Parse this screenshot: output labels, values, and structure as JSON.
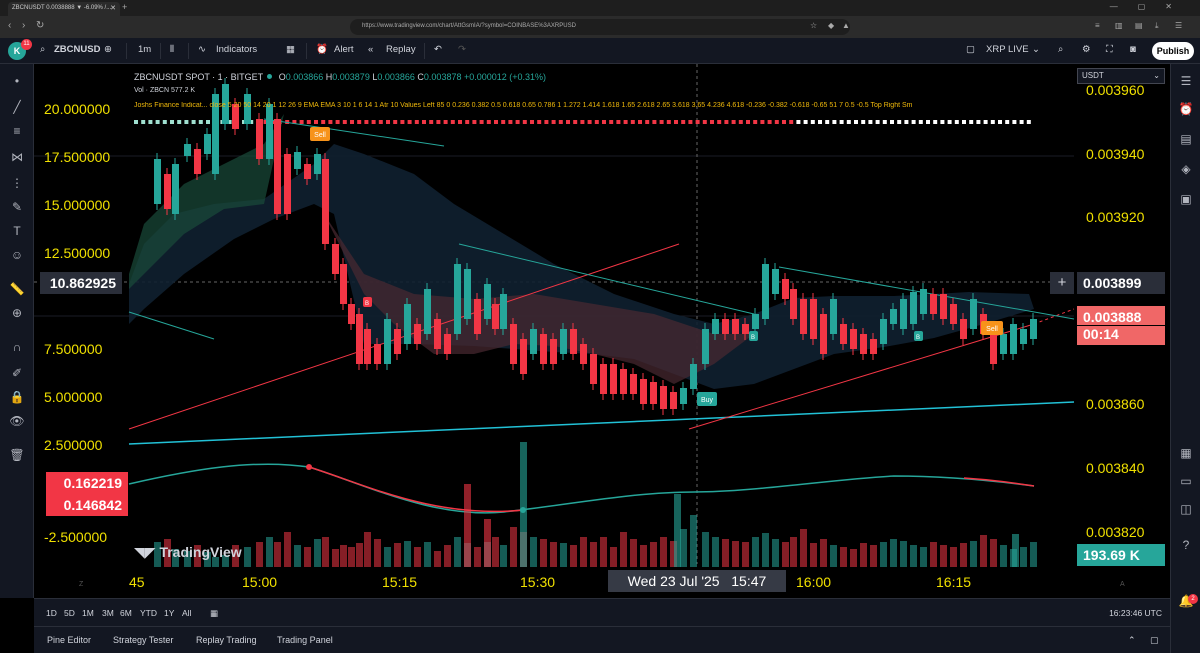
{
  "browser": {
    "tab_title": "ZBCNUSDT 0.0038888 ▼ -6.09% /...",
    "url": "https://www.tradingview.com/chart/AttGsmIA/?symbol=COINBASE%3AXRPUSD"
  },
  "header": {
    "avatar_letter": "K",
    "avatar_badge": "11",
    "symbol": "ZBCNUSD",
    "interval": "1m",
    "indicators": "Indicators",
    "alert": "Alert",
    "replay": "Replay",
    "watchlist": "XRP LIVE",
    "publish": "Publish"
  },
  "legend": {
    "title": "ZBCNUSDT SPOT · 1 · BITGET",
    "o_label": "O",
    "o": "0.003866",
    "h_label": "H",
    "h": "0.003879",
    "l_label": "L",
    "l": "0.003866",
    "c_label": "C",
    "c": "0.003878",
    "change": "+0.000012 (+0.31%)",
    "vol": "Vol · ZBCN   577.2 K",
    "josh": "Joshs Finance Indicat...   close 5 20 50 14 20 1 12 26 9 EMA EMA 3 10 1 6 14 1 Atr 10 Values Left 85 0 0.236 0.382 0.5 0.618 0.65 0.786 1 1.272 1.414 1.618 1.65 2.618 2.65 3.618 3.65 4.236 4.618 -0.236 -0.382 -0.618 -0.65 51 7 0.5 -0.5 Top Right Sm"
  },
  "scale_select": "USDT",
  "right_axis": [
    "0.003960",
    "0.003940",
    "0.003920",
    "0.003860",
    "0.003840",
    "0.003820"
  ],
  "left_axis": [
    "20.000000",
    "17.500000",
    "15.000000",
    "12.500000",
    "7.500000",
    "5.000000",
    "2.500000",
    "-2.500000"
  ],
  "left_tags": {
    "crosshair": "10.862925",
    "osc_a": "0.162219",
    "osc_b": "0.146842"
  },
  "right_tags": {
    "crosshair": "0.003899",
    "last": "0.003888",
    "countdown": "00:14",
    "volume": "193.69 K"
  },
  "time_axis": [
    "45",
    "15:00",
    "15:15",
    "15:30",
    "16:00",
    "16:15"
  ],
  "crosshair_time": {
    "date": "Wed 23 Jul '25",
    "time": "15:47"
  },
  "signals": {
    "sell": "Sell",
    "buy": "Buy",
    "b": "B"
  },
  "logo": "TradingView",
  "time_ranges": [
    "1D",
    "5D",
    "1M",
    "3M",
    "6M",
    "YTD",
    "1Y",
    "All"
  ],
  "clock": "16:23:46 UTC",
  "bottom_tabs": [
    "Pine Editor",
    "Strategy Tester",
    "Replay Trading",
    "Trading Panel"
  ],
  "colors": {
    "up": "#26a69a",
    "down": "#f23645",
    "accent": "#f0b90b",
    "bg": "#000000"
  }
}
